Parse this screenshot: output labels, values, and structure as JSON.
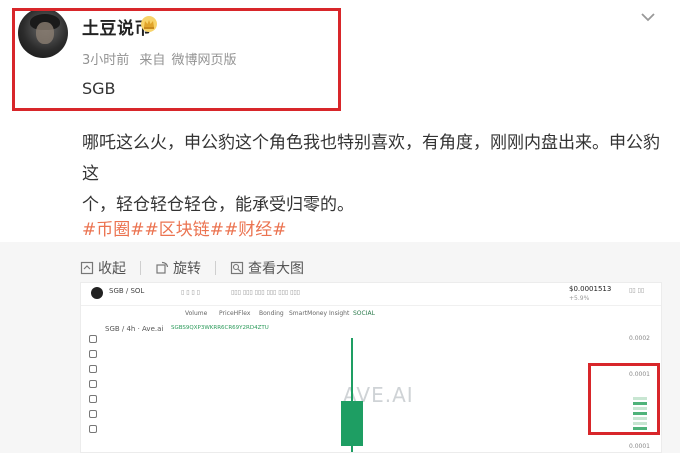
{
  "post": {
    "author": "土豆说币",
    "time": "3小时前",
    "source_prefix": "来自",
    "source": "微博网页版",
    "tag_line": "SGB",
    "text_line1": "哪吒这么火，申公豹这个角色我也特别喜欢，有角度，刚刚内盘出来。申公豹这",
    "text_line2": "个，轻仓轻仓轻仓，能承受归零的。",
    "hashtags": [
      "#币圈#",
      "#区块链#",
      "#财经#"
    ]
  },
  "image_toolbar": {
    "collect": "收起",
    "rotate": "旋转",
    "view_large": "查看大图"
  },
  "chart_shot": {
    "pair": "SGB / SOL",
    "price": "$0.0001513",
    "price_sub": "+5.9%",
    "tabs": [
      "Volume",
      "PriceHFlex",
      "Bonding",
      "SmartMoney",
      "Insight",
      "SOCIAL"
    ],
    "series_label": "SGB / 4h · Ave.ai",
    "series_src": "SGBS9QXP3WKRR6CR69Y2RD4ZTU",
    "axis_labels": [
      "0.0002",
      "0.0001",
      "0.0001"
    ],
    "watermark": "AVE.AI",
    "candle_color": "#1e9e63"
  },
  "icons": {
    "crown": "crown-icon",
    "more": "chevron-down-icon",
    "collect": "collapse-icon",
    "rotate": "rotate-icon",
    "view": "zoom-icon"
  },
  "colors": {
    "highlight": "#d8262a",
    "hashtag": "#eb7350"
  }
}
